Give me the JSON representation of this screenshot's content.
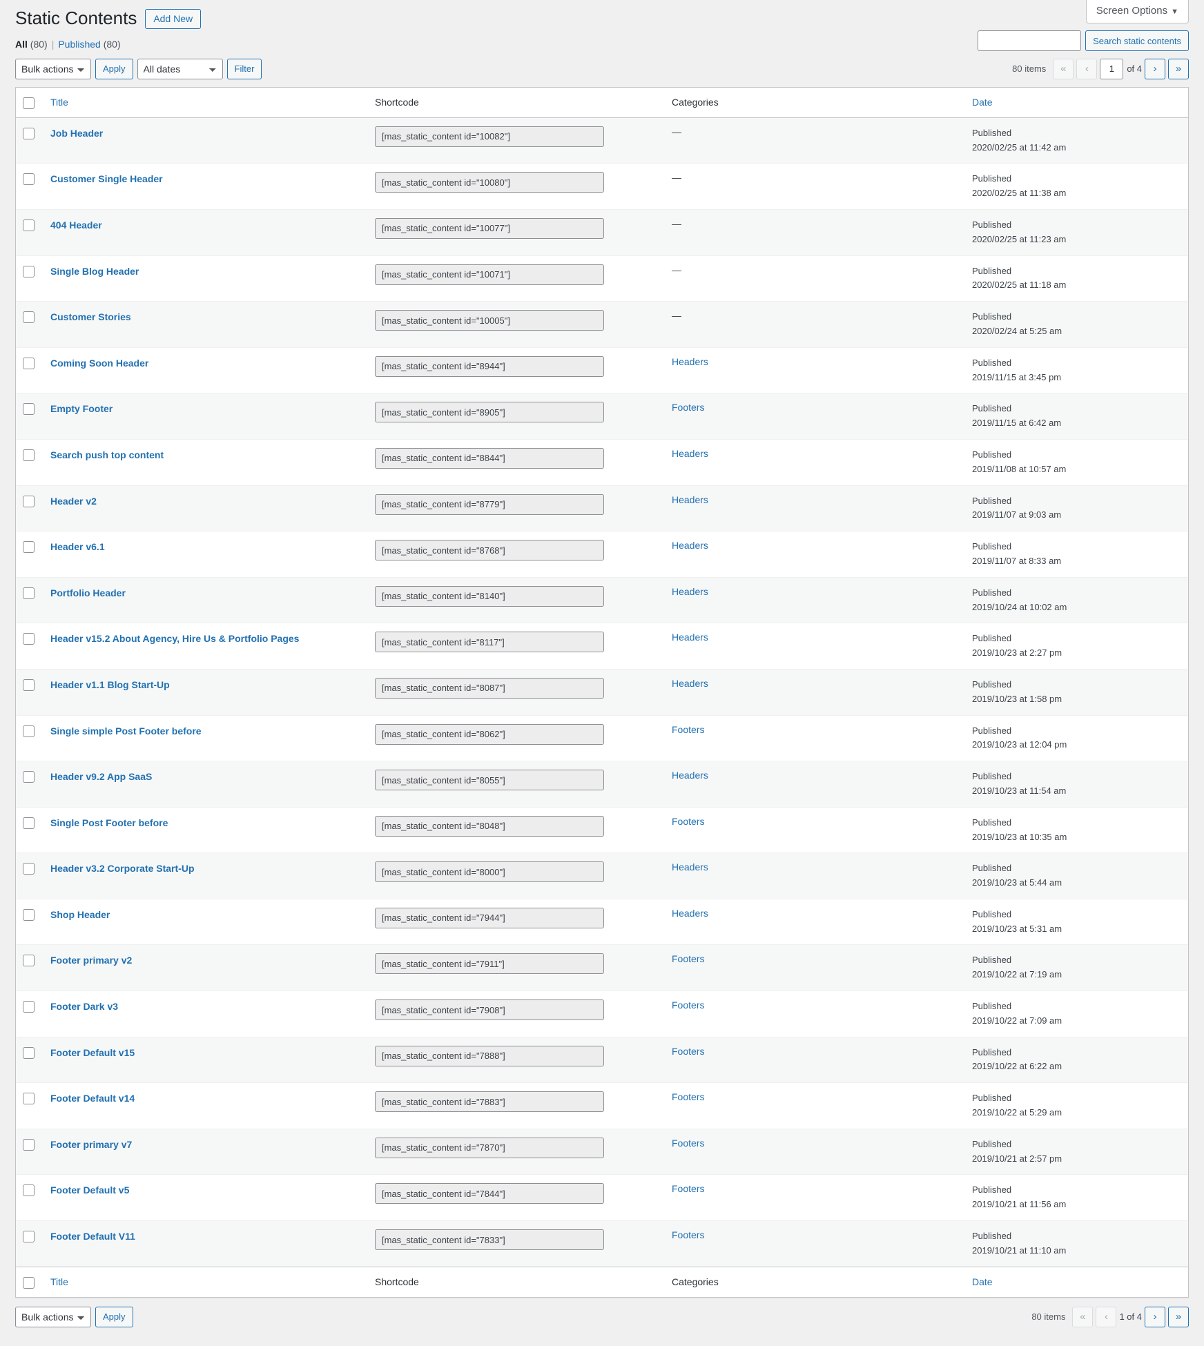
{
  "screen_options": {
    "label": "Screen Options",
    "caret": "▼"
  },
  "header": {
    "title": "Static Contents",
    "add_new_label": "Add New"
  },
  "status_filters": [
    {
      "label": "All",
      "count": "(80)",
      "current": true
    },
    {
      "label": "Published",
      "count": "(80)",
      "current": false
    }
  ],
  "status_separator": "|",
  "search": {
    "value": "",
    "placeholder": "",
    "button_label": "Search static contents"
  },
  "tablenav_top": {
    "bulk_actions_label": "Bulk actions",
    "apply_label": "Apply",
    "dates_label": "All dates",
    "filter_label": "Filter",
    "items_count": "80 items",
    "first_page_icon": "«",
    "prev_page_icon": "‹",
    "current_page": "1",
    "of_total": "of 4",
    "next_page_icon": "›",
    "last_page_icon": "»"
  },
  "tablenav_bottom": {
    "bulk_actions_label": "Bulk actions",
    "apply_label": "Apply",
    "items_count": "80 items",
    "first_page_icon": "«",
    "prev_page_icon": "‹",
    "paging_text": "1 of 4",
    "next_page_icon": "›",
    "last_page_icon": "»"
  },
  "table": {
    "columns": {
      "title": "Title",
      "shortcode": "Shortcode",
      "categories": "Categories",
      "date": "Date"
    },
    "rows": [
      {
        "title": "Job Header",
        "shortcode": "[mas_static_content id=\"10082\"]",
        "category": "—",
        "category_link": false,
        "status": "Published",
        "stamp": "2020/02/25 at 11:42 am"
      },
      {
        "title": "Customer Single Header",
        "shortcode": "[mas_static_content id=\"10080\"]",
        "category": "—",
        "category_link": false,
        "status": "Published",
        "stamp": "2020/02/25 at 11:38 am"
      },
      {
        "title": "404 Header",
        "shortcode": "[mas_static_content id=\"10077\"]",
        "category": "—",
        "category_link": false,
        "status": "Published",
        "stamp": "2020/02/25 at 11:23 am"
      },
      {
        "title": "Single Blog Header",
        "shortcode": "[mas_static_content id=\"10071\"]",
        "category": "—",
        "category_link": false,
        "status": "Published",
        "stamp": "2020/02/25 at 11:18 am"
      },
      {
        "title": "Customer Stories",
        "shortcode": "[mas_static_content id=\"10005\"]",
        "category": "—",
        "category_link": false,
        "status": "Published",
        "stamp": "2020/02/24 at 5:25 am"
      },
      {
        "title": "Coming Soon Header",
        "shortcode": "[mas_static_content id=\"8944\"]",
        "category": "Headers",
        "category_link": true,
        "status": "Published",
        "stamp": "2019/11/15 at 3:45 pm"
      },
      {
        "title": "Empty Footer",
        "shortcode": "[mas_static_content id=\"8905\"]",
        "category": "Footers",
        "category_link": true,
        "status": "Published",
        "stamp": "2019/11/15 at 6:42 am"
      },
      {
        "title": "Search push top content",
        "shortcode": "[mas_static_content id=\"8844\"]",
        "category": "Headers",
        "category_link": true,
        "status": "Published",
        "stamp": "2019/11/08 at 10:57 am"
      },
      {
        "title": "Header v2",
        "shortcode": "[mas_static_content id=\"8779\"]",
        "category": "Headers",
        "category_link": true,
        "status": "Published",
        "stamp": "2019/11/07 at 9:03 am"
      },
      {
        "title": "Header v6.1",
        "shortcode": "[mas_static_content id=\"8768\"]",
        "category": "Headers",
        "category_link": true,
        "status": "Published",
        "stamp": "2019/11/07 at 8:33 am"
      },
      {
        "title": "Portfolio Header",
        "shortcode": "[mas_static_content id=\"8140\"]",
        "category": "Headers",
        "category_link": true,
        "status": "Published",
        "stamp": "2019/10/24 at 10:02 am"
      },
      {
        "title": "Header v15.2 About Agency, Hire Us & Portfolio Pages",
        "shortcode": "[mas_static_content id=\"8117\"]",
        "category": "Headers",
        "category_link": true,
        "status": "Published",
        "stamp": "2019/10/23 at 2:27 pm"
      },
      {
        "title": "Header v1.1 Blog Start-Up",
        "shortcode": "[mas_static_content id=\"8087\"]",
        "category": "Headers",
        "category_link": true,
        "status": "Published",
        "stamp": "2019/10/23 at 1:58 pm"
      },
      {
        "title": "Single simple Post Footer before",
        "shortcode": "[mas_static_content id=\"8062\"]",
        "category": "Footers",
        "category_link": true,
        "status": "Published",
        "stamp": "2019/10/23 at 12:04 pm"
      },
      {
        "title": "Header v9.2 App SaaS",
        "shortcode": "[mas_static_content id=\"8055\"]",
        "category": "Headers",
        "category_link": true,
        "status": "Published",
        "stamp": "2019/10/23 at 11:54 am"
      },
      {
        "title": "Single Post Footer before",
        "shortcode": "[mas_static_content id=\"8048\"]",
        "category": "Footers",
        "category_link": true,
        "status": "Published",
        "stamp": "2019/10/23 at 10:35 am"
      },
      {
        "title": "Header v3.2 Corporate Start-Up",
        "shortcode": "[mas_static_content id=\"8000\"]",
        "category": "Headers",
        "category_link": true,
        "status": "Published",
        "stamp": "2019/10/23 at 5:44 am"
      },
      {
        "title": "Shop Header",
        "shortcode": "[mas_static_content id=\"7944\"]",
        "category": "Headers",
        "category_link": true,
        "status": "Published",
        "stamp": "2019/10/23 at 5:31 am"
      },
      {
        "title": "Footer primary v2",
        "shortcode": "[mas_static_content id=\"7911\"]",
        "category": "Footers",
        "category_link": true,
        "status": "Published",
        "stamp": "2019/10/22 at 7:19 am"
      },
      {
        "title": "Footer Dark v3",
        "shortcode": "[mas_static_content id=\"7908\"]",
        "category": "Footers",
        "category_link": true,
        "status": "Published",
        "stamp": "2019/10/22 at 7:09 am"
      },
      {
        "title": "Footer Default v15",
        "shortcode": "[mas_static_content id=\"7888\"]",
        "category": "Footers",
        "category_link": true,
        "status": "Published",
        "stamp": "2019/10/22 at 6:22 am"
      },
      {
        "title": "Footer Default v14",
        "shortcode": "[mas_static_content id=\"7883\"]",
        "category": "Footers",
        "category_link": true,
        "status": "Published",
        "stamp": "2019/10/22 at 5:29 am"
      },
      {
        "title": "Footer primary v7",
        "shortcode": "[mas_static_content id=\"7870\"]",
        "category": "Footers",
        "category_link": true,
        "status": "Published",
        "stamp": "2019/10/21 at 2:57 pm"
      },
      {
        "title": "Footer Default v5",
        "shortcode": "[mas_static_content id=\"7844\"]",
        "category": "Footers",
        "category_link": true,
        "status": "Published",
        "stamp": "2019/10/21 at 11:56 am"
      },
      {
        "title": "Footer Default V11",
        "shortcode": "[mas_static_content id=\"7833\"]",
        "category": "Footers",
        "category_link": true,
        "status": "Published",
        "stamp": "2019/10/21 at 11:10 am"
      }
    ]
  },
  "colors": {
    "link": "#2271b1",
    "page_bg": "#f0f0f1",
    "row_alt": "#f6f7f7",
    "border": "#c3c4c7"
  }
}
